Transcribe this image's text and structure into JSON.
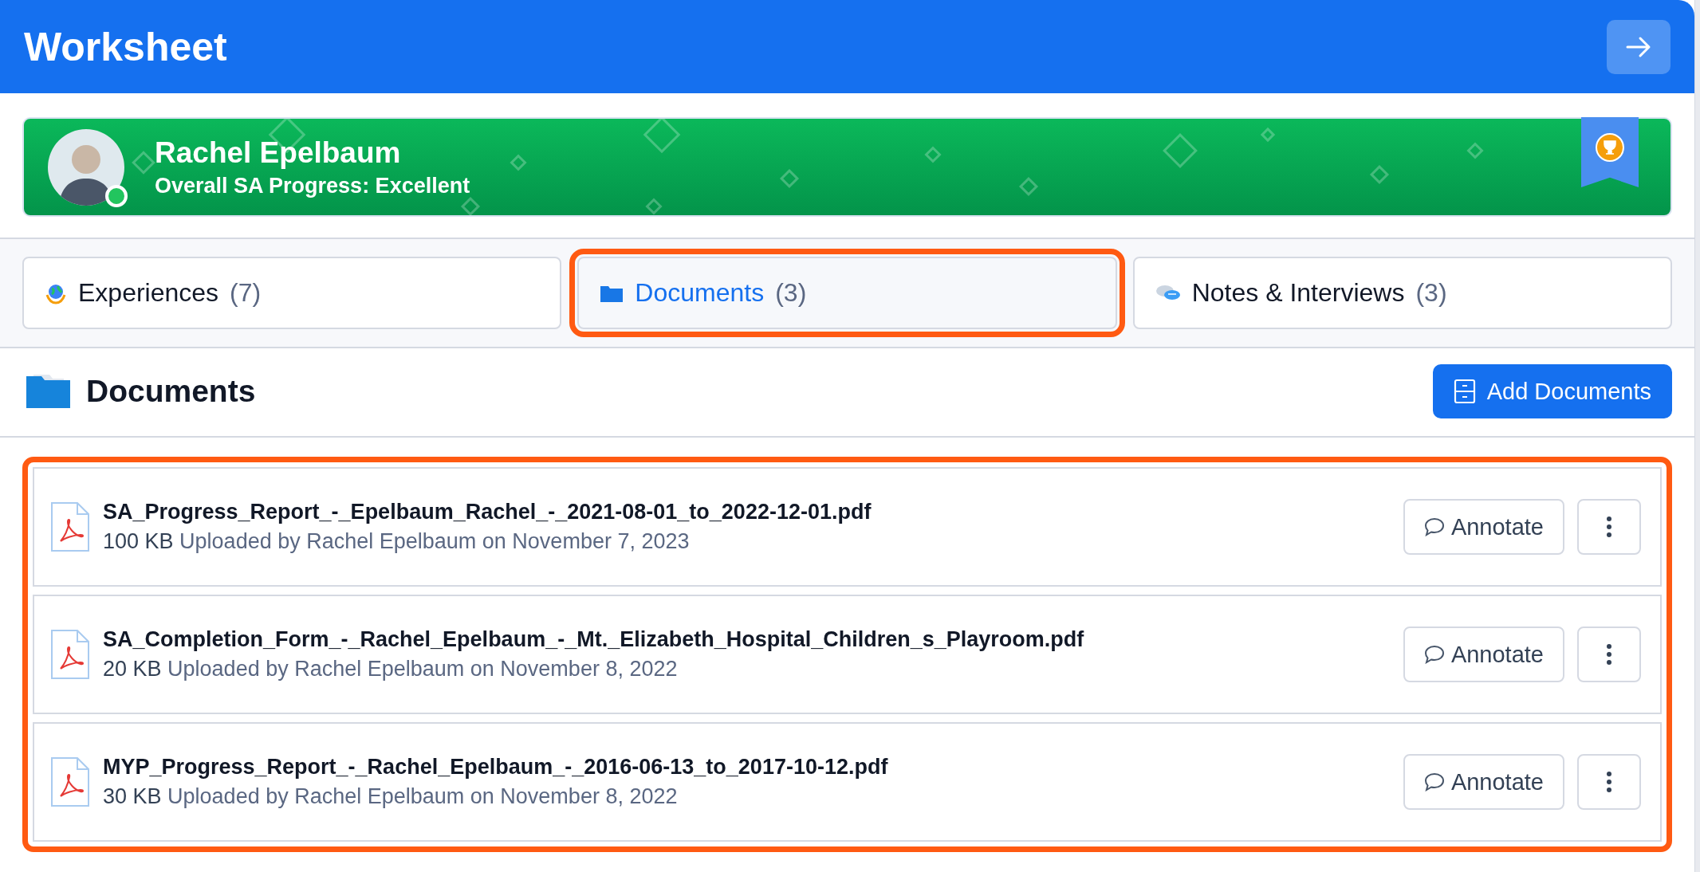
{
  "header": {
    "title": "Worksheet"
  },
  "profile": {
    "name": "Rachel Epelbaum",
    "progress": "Overall SA Progress: Excellent",
    "online": true,
    "award": true
  },
  "tabs": [
    {
      "kind": "globe",
      "label": "Experiences",
      "count": "(7)",
      "selected": false,
      "highlighted": false
    },
    {
      "kind": "folder",
      "label": "Documents",
      "count": "(3)",
      "selected": true,
      "highlighted": true
    },
    {
      "kind": "chat",
      "label": "Notes & Interviews",
      "count": "(3)",
      "selected": false,
      "highlighted": false
    }
  ],
  "section": {
    "title": "Documents",
    "add_button": "Add Documents"
  },
  "documents_highlighted": true,
  "documents": [
    {
      "filename": "SA_Progress_Report_-_Epelbaum_Rachel_-_2021-08-01_to_2022-12-01.pdf",
      "size": "100 KB",
      "uploaded": "Uploaded by Rachel Epelbaum on November 7, 2023",
      "action": "Annotate"
    },
    {
      "filename": "SA_Completion_Form_-_Rachel_Epelbaum_-_Mt._Elizabeth_Hospital_Children_s_Playroom.pdf",
      "size": "20 KB",
      "uploaded": "Uploaded by Rachel Epelbaum on November 8, 2022",
      "action": "Annotate"
    },
    {
      "filename": "MYP_Progress_Report_-_Rachel_Epelbaum_-_2016-06-13_to_2017-10-12.pdf",
      "size": "30 KB",
      "uploaded": "Uploaded by Rachel Epelbaum on November 8, 2022",
      "action": "Annotate"
    }
  ]
}
